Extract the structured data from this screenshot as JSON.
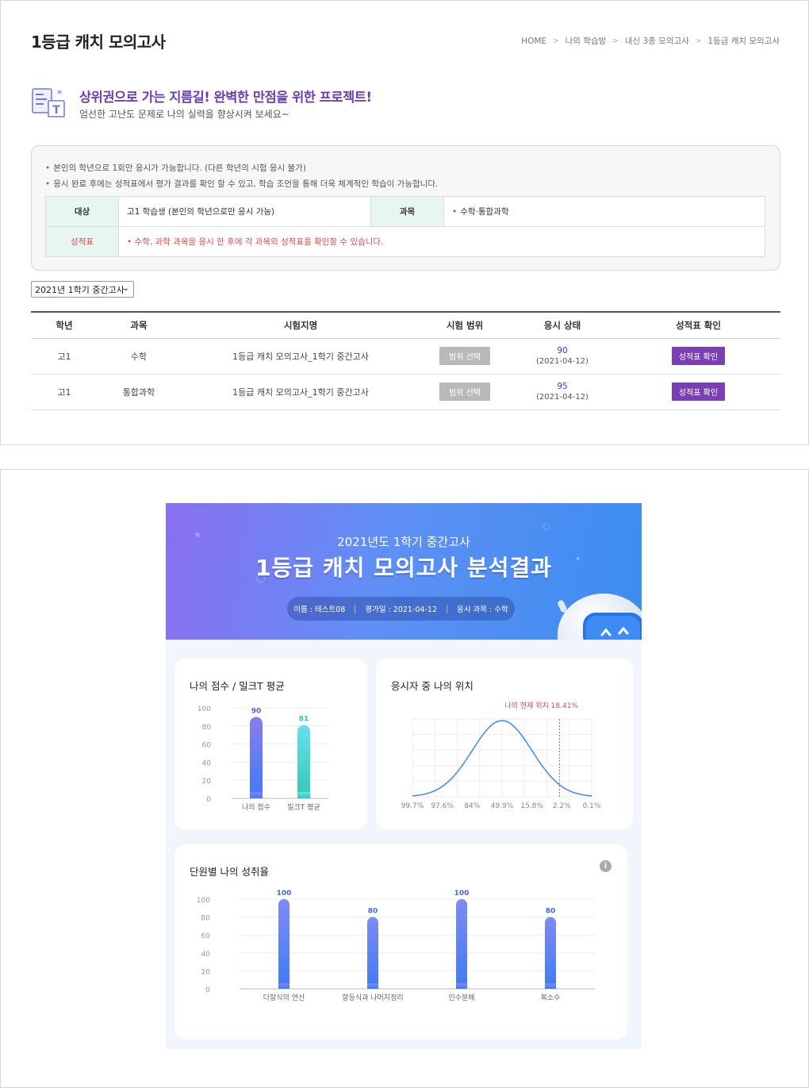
{
  "page": {
    "title": "1등급 캐치 모의고사",
    "breadcrumb": [
      "HOME",
      "나의 학습방",
      "내신 3종 모의고사",
      "1등급 캐치 모의고사"
    ]
  },
  "promo": {
    "title": "상위권으로 가는 지름길! 완벽한 만점을 위한 프로젝트!",
    "subtitle": "엄선한 고난도 문제로 나의 실력을 향상시켜 보세요~"
  },
  "notice": {
    "notes": [
      "본인의 학년으로 1회만 응시가 가능합니다. (다른 학년의 시험 응시 불가)",
      "응시 완료 후에는 성적표에서 평가 결과를 확인 할 수 있고, 학습 조언을 통해 더욱 체계적인 학습이 가능합니다."
    ],
    "target_label": "대상",
    "target_value": "고1 학습생 (본인의 학년으로만 응시 가능)",
    "subject_label": "과목",
    "subject_value": "수학·통합과학",
    "report_label": "성적표",
    "report_value": "수학, 과학 과목을 응시 한 후에 각 과목의 성적표를 확인할 수 있습니다."
  },
  "term_select": {
    "value": "2021년 1학기 중간고사"
  },
  "exam_table": {
    "headers": [
      "학년",
      "과목",
      "시험지명",
      "시험 범위",
      "응시 상태",
      "성적표 확인"
    ],
    "rows": [
      {
        "grade": "고1",
        "subject": "수학",
        "name": "1등급 캐치 모의고사_1학기 중간고사",
        "range_btn": "범위 선택",
        "score": "90",
        "date": "(2021-04-12)",
        "report_btn": "성적표 확인"
      },
      {
        "grade": "고1",
        "subject": "통합과학",
        "name": "1등급 캐치 모의고사_1학기 중간고사",
        "range_btn": "범위 선택",
        "score": "95",
        "date": "(2021-04-12)",
        "report_btn": "성적표 확인"
      }
    ]
  },
  "report": {
    "banner_sub": "2021년도 1학기 중간고사",
    "banner_title": "1등급 캐치 모의고사 분석결과",
    "info": [
      "이름 : 테스트08",
      "평가일 : 2021-04-12",
      "응시 과목 : 수학"
    ],
    "card1_title": "나의 점수 / 밀크T 평균",
    "card2_title": "응시자 중 나의 위치",
    "card3_title": "단원별 나의 성취율",
    "info_icon": "i"
  },
  "chart_data": [
    {
      "type": "bar",
      "title": "나의 점수 / 밀크T 평균",
      "categories": [
        "나의 점수",
        "밀크T 평균"
      ],
      "values": [
        90,
        81
      ],
      "ylim": [
        0,
        100
      ],
      "yticks": [
        "100",
        "80",
        "60",
        "40",
        "20",
        "0"
      ],
      "colors": [
        "#5b79f0",
        "#3ed3c8"
      ]
    },
    {
      "type": "line",
      "title": "응시자 중 나의 위치",
      "x_labels": [
        "99.7%",
        "97.6%",
        "84%",
        "49.9%",
        "15.8%",
        "2.2%",
        "0.1%"
      ],
      "annotation": "나의 현재 위치 18.41%",
      "marker_position": 0.82,
      "grid": true
    },
    {
      "type": "bar",
      "title": "단원별 나의 성취율",
      "categories": [
        "다항식의 연산",
        "항등식과 나머지정리",
        "인수분해",
        "복소수"
      ],
      "values": [
        100,
        80,
        100,
        80
      ],
      "ylim": [
        0,
        100
      ],
      "yticks": [
        "100",
        "80",
        "60",
        "40",
        "20",
        "0"
      ],
      "colors": [
        "#5b79f0"
      ]
    }
  ]
}
